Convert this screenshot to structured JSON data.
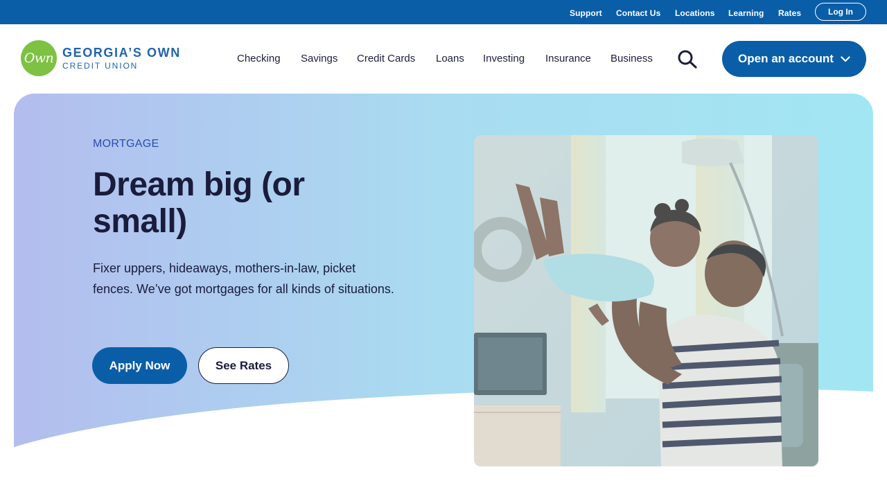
{
  "utility_nav": {
    "links": [
      "Support",
      "Contact Us",
      "Locations",
      "Learning",
      "Rates"
    ],
    "login_label": "Log In"
  },
  "brand": {
    "badge_text": "Own",
    "name_line1": "GEORGIA’S OWN",
    "name_line2": "CREDIT UNION",
    "colors": {
      "primary": "#0a5ea8",
      "badge_green": "#7dc243",
      "navy_text": "#1c1d3a"
    }
  },
  "main_nav": {
    "items": [
      "Checking",
      "Savings",
      "Credit Cards",
      "Loans",
      "Investing",
      "Insurance",
      "Business"
    ],
    "search_icon": "search-icon",
    "cta_label": "Open an account",
    "cta_icon": "chevron-down-icon"
  },
  "hero": {
    "eyebrow": "MORTGAGE",
    "headline": "Dream big (or small)",
    "subtext": "Fixer uppers, hideaways, mothers-in-law, picket fences. We’ve got mortgages for all kinds of situations.",
    "primary_button": "Apply Now",
    "secondary_button": "See Rates",
    "image_description_icon": "family-photo"
  }
}
